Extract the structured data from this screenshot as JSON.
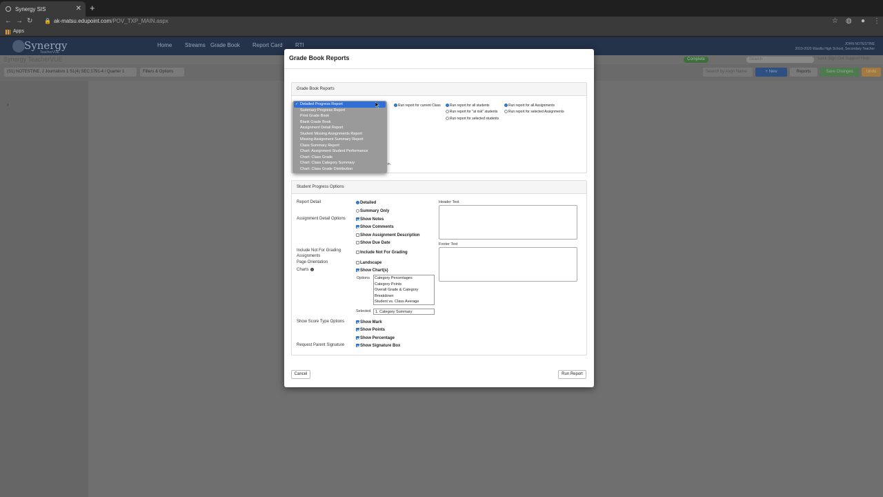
{
  "browser": {
    "tab_title": "Synergy SIS",
    "url_host": "ak-matsu.edupoint.com",
    "url_path": "/POV_TXP_MAIN.aspx",
    "bookmark_apps": "Apps"
  },
  "app": {
    "logo_text": "Synergy",
    "logo_sub": "TeacherVUE",
    "nav": [
      "Home",
      "Streams",
      "Grade Book",
      "Report Card",
      "RTI"
    ],
    "user_name": "JOHN NOTESTINE",
    "user_detail": "2019-2020 Wasilla High School, Secondary Teacher",
    "brand2": "Synergy TeacherVUE",
    "complete": "Complete",
    "search_placeholder": "Search",
    "links": "Lock   Sign Out   Support   Help",
    "class_select": "(S1) NOTESTINE, J Journalism 1 S1(4) SEC:1791-4 / Quarter 1",
    "filters": "Filters & Options",
    "asgn_search": "Search by Asgn Name",
    "new_btn": "+ New",
    "reports_btn": "Reports",
    "save_btn": "Save Changes",
    "undo_btn": "Undo"
  },
  "modal": {
    "title": "Grade Book Reports",
    "gb_reports_head": "Grade Book Reports",
    "report_types": [
      "Detailed Progress Report",
      "Summary Progress Report",
      "Print Grade Book",
      "Blank Grade Book",
      "Assignment Detail Report",
      "Student Missing Assignments Report",
      "Missing Assignment Summary Report",
      "Class Summary Report",
      "Chart: Assignment Student Performance",
      "Chart: Class Grade",
      "Chart: Class Category Summary",
      "Chart: Class Grade Distribution"
    ],
    "selected_report": "Detailed Progress Report",
    "run_current_class": "Run report for current Class",
    "run_all_students": "Run report for all students",
    "run_at_risk": "Run report for \"at risk\" students",
    "run_selected_students": "Run report for selected students",
    "run_all_assignments": "Run report for all Assignments",
    "run_selected_assignments": "Run report for selected Assignments",
    "truncated_text": "on.",
    "spo_head": "Student Progress Options",
    "report_detail_label": "Report Detail",
    "detailed": "Detailed",
    "summary_only": "Summary Only",
    "assignment_detail_label": "Assignment Detail Options",
    "show_notes": "Show Notes",
    "show_comments": "Show Comments",
    "show_assignment_description": "Show Assignment Description",
    "show_due_date": "Show Due Date",
    "include_nfg_label_1": "Include Not For Grading",
    "include_nfg_label_2": "Assignments",
    "include_nfg": "Include Not For Grading",
    "page_orientation_label": "Page Orientation",
    "landscape": "Landscape",
    "charts_label": "Charts",
    "show_charts": "Show Chart(s)",
    "options_label": "Options",
    "chart_options": [
      "Category Percentages",
      "Category Points",
      "Overall Grade & Category",
      "Breakdown",
      "Student vs. Class Average"
    ],
    "selected_label": "Selected",
    "selected_value": "1. Category Summary",
    "score_type_label": "Show Score Type Options",
    "show_mark": "Show Mark",
    "show_points": "Show Points",
    "show_percentage": "Show Percentage",
    "parent_sig_label": "Request Parent Signature",
    "show_sig_box": "Show Signature Box",
    "header_text_label": "Header Text",
    "footer_text_label": "Footer Text",
    "cancel": "Cancel",
    "run_report": "Run Report"
  },
  "colors": {
    "accent": "#3a7fd8",
    "dropdown_bg": "#9a9a9a",
    "selected_bg": "#2f6fd6"
  }
}
